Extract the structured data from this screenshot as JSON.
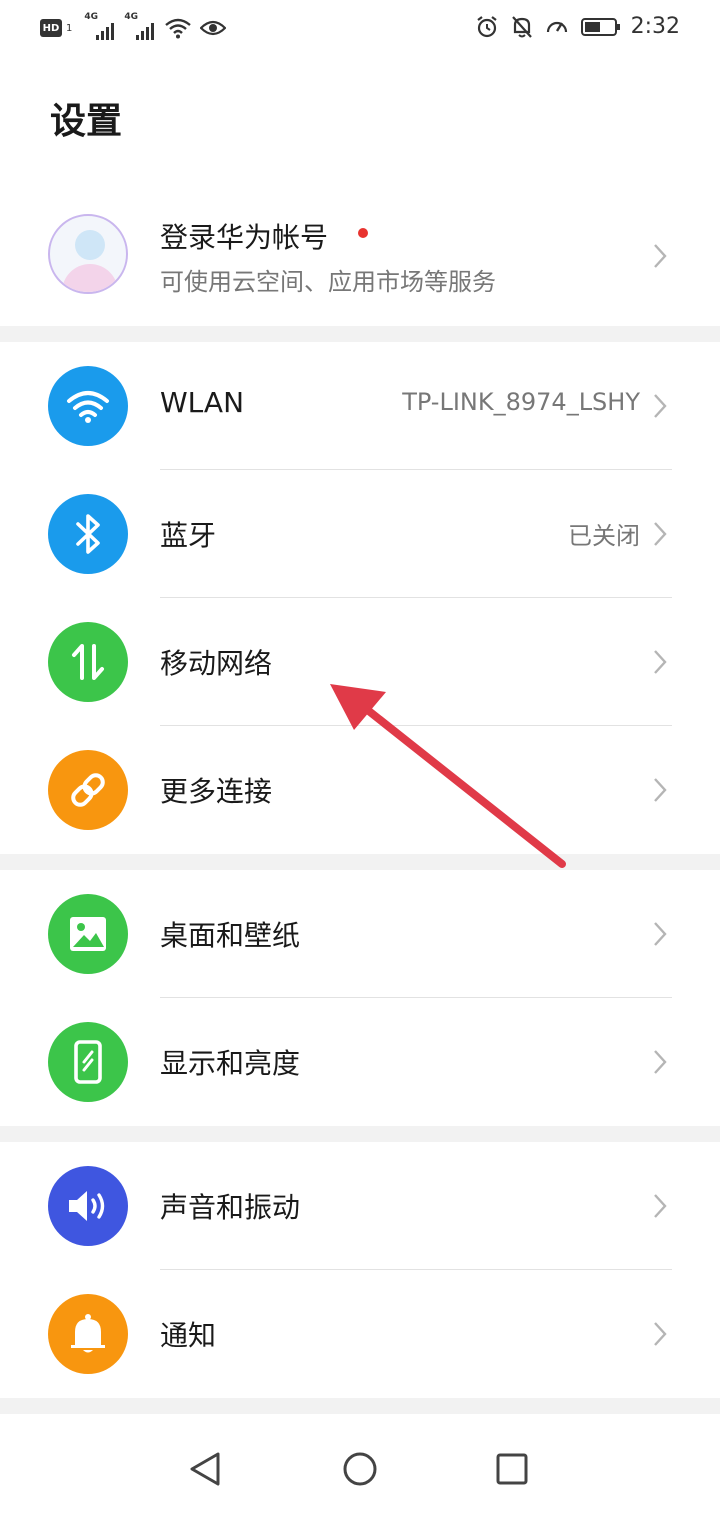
{
  "status_bar": {
    "hd": "HD",
    "sim": "1",
    "network_1": "4G",
    "network_2": "4G",
    "time": "2:32"
  },
  "page": {
    "title": "设置"
  },
  "account": {
    "title": "登录华为帐号",
    "subtitle": "可使用云空间、应用市场等服务"
  },
  "items": [
    {
      "label": "WLAN",
      "value": "TP-LINK_8974_LSHY",
      "icon": "wifi-icon",
      "color": "#1a9bec"
    },
    {
      "label": "蓝牙",
      "value": "已关闭",
      "icon": "bluetooth-icon",
      "color": "#1a9bec"
    },
    {
      "label": "移动网络",
      "value": "",
      "icon": "mobile-data-icon",
      "color": "#3cc54a"
    },
    {
      "label": "更多连接",
      "value": "",
      "icon": "link-icon",
      "color": "#f8960f"
    },
    {
      "label": "桌面和壁纸",
      "value": "",
      "icon": "wallpaper-icon",
      "color": "#3cc54a"
    },
    {
      "label": "显示和亮度",
      "value": "",
      "icon": "display-icon",
      "color": "#3cc54a"
    },
    {
      "label": "声音和振动",
      "value": "",
      "icon": "sound-icon",
      "color": "#3f56e0"
    },
    {
      "label": "通知",
      "value": "",
      "icon": "bell-icon",
      "color": "#f8960f"
    }
  ],
  "colors": {
    "accent_red": "#e8332f",
    "annotation_arrow": "#e03a48"
  }
}
